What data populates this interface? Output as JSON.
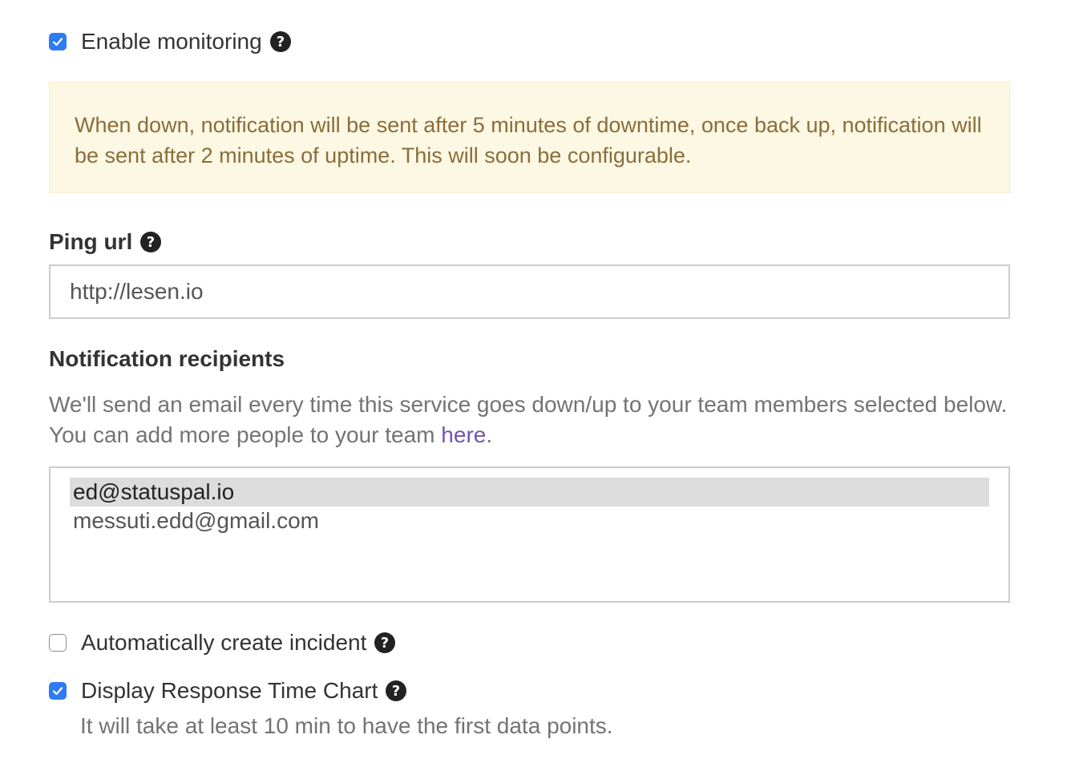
{
  "monitoring": {
    "label": "Enable monitoring",
    "checked": true
  },
  "alert": {
    "text": "When down, notification will be sent after 5 minutes of downtime, once back up, notification will be sent after 2 minutes of uptime. This will soon be configurable."
  },
  "ping_url": {
    "label": "Ping url",
    "value": "http://lesen.io"
  },
  "recipients": {
    "label": "Notification recipients",
    "help_text": "We'll send an email every time this service goes down/up to your team members selected below. You can add more people to your team ",
    "link_text": "here",
    "help_suffix": ".",
    "options": [
      {
        "email": "ed@statuspal.io",
        "selected": true
      },
      {
        "email": "messuti.edd@gmail.com",
        "selected": false
      }
    ]
  },
  "auto_incident": {
    "label": "Automatically create incident",
    "checked": false
  },
  "response_chart": {
    "label": "Display Response Time Chart",
    "checked": true,
    "note": "It will take at least 10 min to have the first data points."
  },
  "icons": {
    "check": "checkmark-icon",
    "help": "question-circle-icon"
  },
  "colors": {
    "checkbox_accent": "#2f7bf5",
    "alert_background": "#fcf8e3",
    "alert_text": "#8a6d3b",
    "link": "#6f55b5"
  }
}
